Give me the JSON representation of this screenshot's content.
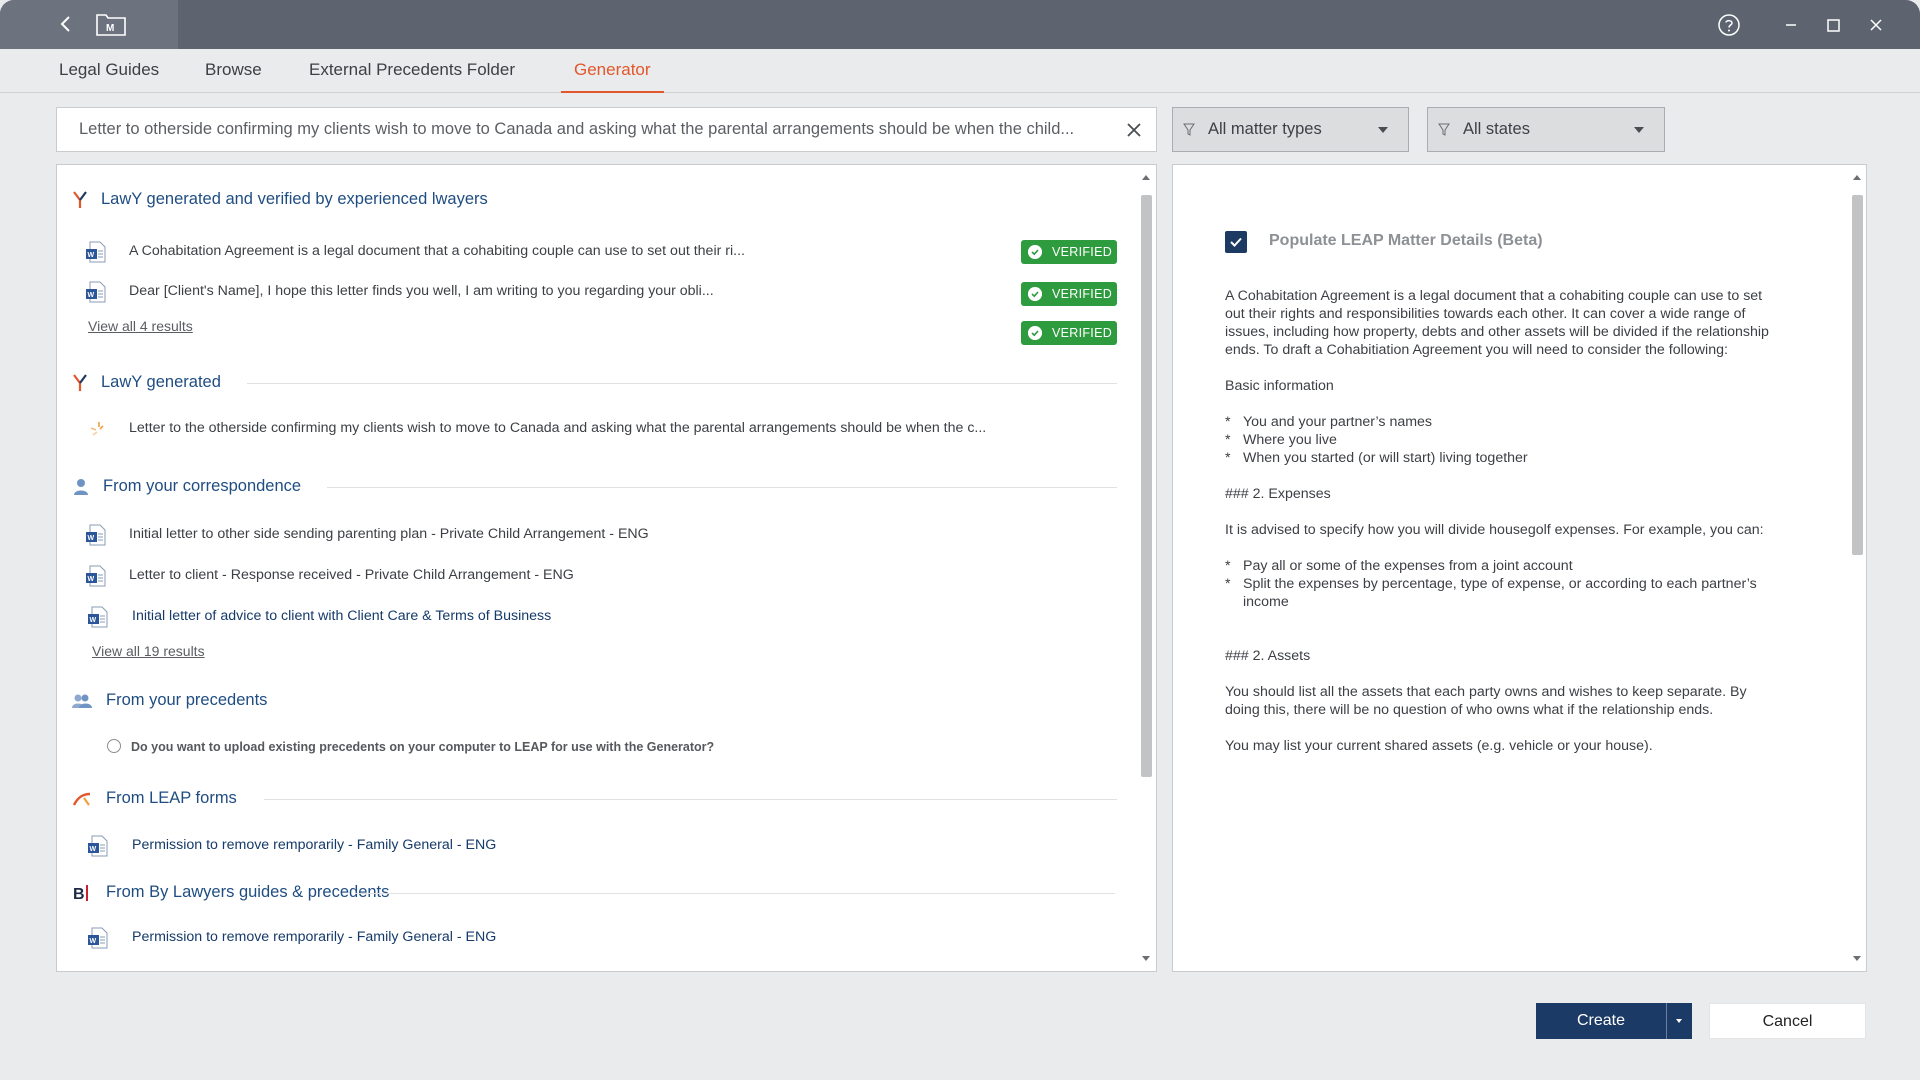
{
  "tabs": [
    {
      "label": "Legal Guides"
    },
    {
      "label": "Browse"
    },
    {
      "label": "External Precedents Folder"
    },
    {
      "label": "Generator"
    }
  ],
  "active_tab": "Generator",
  "search": {
    "value": "Letter to otherside confirming my clients wish to move to Canada and asking what the parental arrangements should be when the child..."
  },
  "filters": {
    "matter_types": "All matter types",
    "states": "All states"
  },
  "sections": {
    "verified": {
      "title": "LawY generated and verified by experienced lwayers",
      "items": [
        {
          "text": "A Cohabitation Agreement is a legal document that a cohabiting couple can use to set out their ri..."
        },
        {
          "text": "Dear [Client's Name], I hope this letter finds you well, I am writing to you regarding your obli..."
        }
      ],
      "badge": "VERIFIED",
      "view_all": "View all 4 results"
    },
    "generated": {
      "title": "LawY generated",
      "items": [
        {
          "text": "Letter to the otherside confirming my clients wish to move to Canada and asking what the parental arrangements should be when the c..."
        }
      ]
    },
    "correspondence": {
      "title": "From your correspondence",
      "items": [
        {
          "text": "Initial letter to other side sending parenting plan - Private Child Arrangement - ENG"
        },
        {
          "text": "Letter to client - Response received - Private Child Arrangement - ENG"
        },
        {
          "text": "Initial letter of advice to client with Client Care & Terms of Business"
        }
      ],
      "view_all": "View all 19 results"
    },
    "precedents": {
      "title": "From your precedents",
      "question": "Do you want to upload existing precedents on your computer to LEAP for use with the Generator?"
    },
    "leap_forms": {
      "title": "From LEAP forms",
      "items": [
        {
          "text": "Permission to remove remporarily - Family General - ENG"
        }
      ]
    },
    "bylawyers": {
      "title": "From By Lawyers guides & precedents",
      "items": [
        {
          "text": "Permission to remove remporarily - Family General - ENG"
        }
      ]
    }
  },
  "preview": {
    "checkbox_label": "Populate LEAP Matter Details (Beta)",
    "checkbox_checked": true,
    "intro": "A Cohabitation Agreement is a legal document that a cohabiting couple can use to set out their rights and responsibilities towards each other. It can cover a wide range of issues, including how property, debts and other assets will be divided if the relationship ends. To draft a Cohabitiation Agreement you will need to consider the following:",
    "basic_heading": "Basic information",
    "basic_bullets": [
      "You and your partner’s names",
      "Where you live",
      "When you started (or will start) living together"
    ],
    "expenses_heading": "### 2. Expenses",
    "expenses_text": "It is advised to specify how you will divide housegolf expenses. For example, you can:",
    "expenses_bullets": [
      "Pay all or some of the expenses from a joint account",
      "Split the expenses by percentage, type of expense, or according to each partner’s income"
    ],
    "assets_heading": "### 2. Assets",
    "assets_text": "You should list all the assets that each party owns and wishes to keep separate. By doing this, there will be no question of who owns what if the relationship ends.",
    "assets_text2": "You may list your current shared assets (e.g. vehicle or your house)."
  },
  "buttons": {
    "create": "Create",
    "cancel": "Cancel"
  },
  "colors": {
    "accent": "#e2572c",
    "primary": "#1c3a66",
    "verified": "#2e9b3f",
    "section_title": "#1f4d82",
    "titlebar": "#5d6470"
  }
}
